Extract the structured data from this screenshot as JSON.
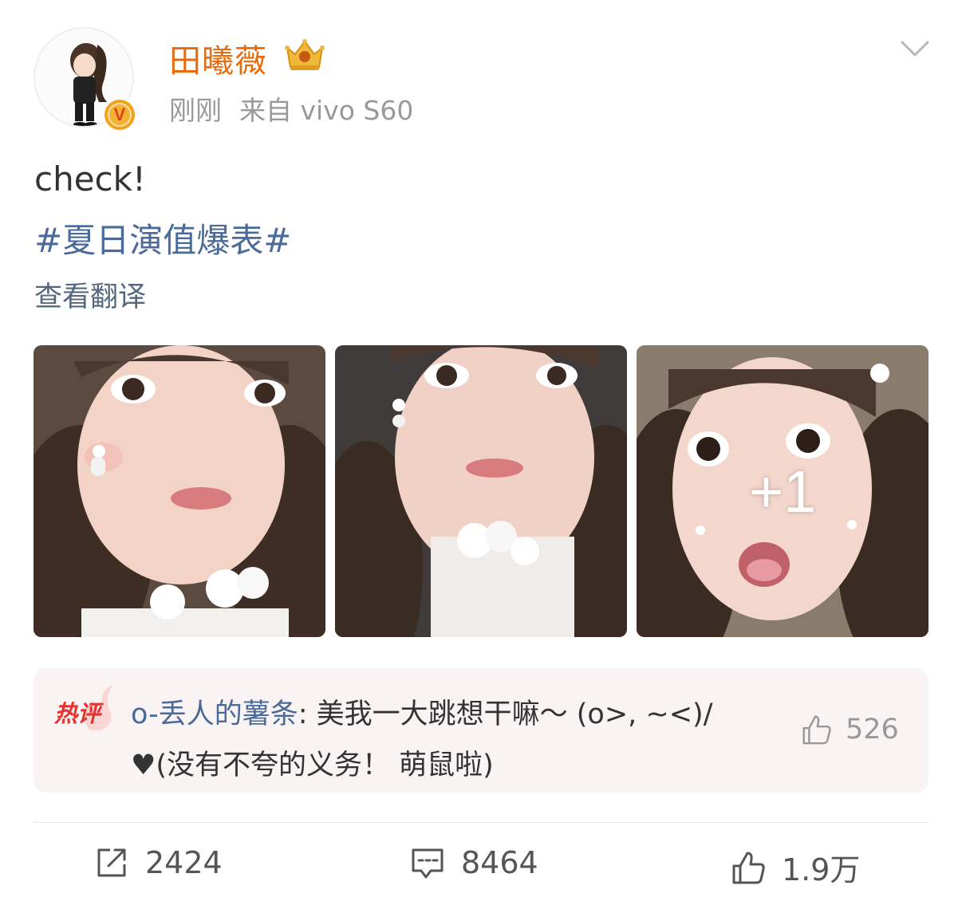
{
  "post": {
    "author": "田曦薇",
    "time": "刚刚",
    "source": "来自 vivo S60",
    "text": "check!",
    "hashtag": "#夏日演值爆表#",
    "translate_label": "查看翻译",
    "photos": [
      {
        "overlay": ""
      },
      {
        "overlay": ""
      },
      {
        "overlay": "+1"
      }
    ]
  },
  "hot_comment": {
    "badge": "热评",
    "commenter": "o-丢人的薯条",
    "text": ": 美我一大跳想干嘛～ (o>, ~<)/♥(没有不夸的义务！ 萌鼠啦)",
    "likes": "526"
  },
  "actions": {
    "reposts": "2424",
    "comments": "8464",
    "likes": "1.9万"
  },
  "colors": {
    "username": "#e86b10",
    "link": "#4a6b9a",
    "hot": "#e5322f"
  }
}
